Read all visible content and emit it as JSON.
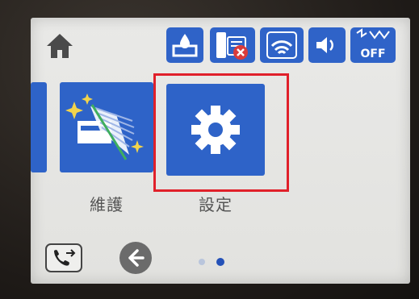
{
  "status_icons": [
    "ink-icon",
    "fax-error-icon",
    "wifi-icon",
    "volume-icon",
    "eco-off-icon"
  ],
  "eco": {
    "state_text": "OFF"
  },
  "menu": {
    "items": [
      {
        "label": "維護",
        "icon": "maintenance-icon"
      },
      {
        "label": "設定",
        "icon": "gear-icon"
      }
    ]
  },
  "pagination": {
    "pages": 2,
    "current": 2
  },
  "colors": {
    "tile": "#2e63c8",
    "highlight": "#e0202a",
    "screen": "#e6e6e3"
  }
}
